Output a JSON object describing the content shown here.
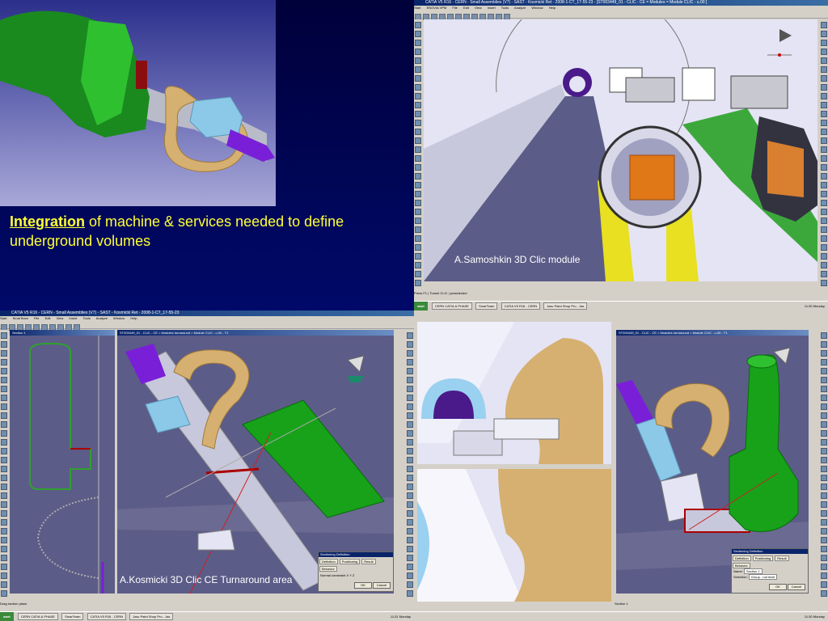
{
  "caption": {
    "keyword": "Integration",
    "text": " of machine & services needed to define underground volumes"
  },
  "credits": {
    "samoshkin": "A.Samoshkin 3D Clic module",
    "kosmicki": "A.Kosmicki 3D Clic CE Turnaround area"
  },
  "catia_top": {
    "title": "CATIA V5 R16 - CERN - Small Assemblies (V7) - SAST - Kosmicki Ret - 2008-1-CT_17-55-23 - [ST003449_01 - CLIC - CE = Modules = Module CLIC - u.00 ]",
    "menu": [
      "Start",
      "ENOVIA VPM",
      "File",
      "Edit",
      "View",
      "Insert",
      "Tools",
      "Analyze",
      "Window",
      "Help"
    ],
    "status": "Press F1 | Tunnel CLIC | preselected",
    "taskbar": {
      "start": "start",
      "buttons": [
        "CERN CATIA & PHASE",
        "SmarTeam",
        "CATIA V5 R16 - CERN",
        "Jasc Paint Shop Pro - Jas"
      ],
      "time": "11:30",
      "day": "Monday"
    }
  },
  "catia_bottom": {
    "title": "CATIA V5 R16 - CERN - Small Assemblies (V7) - SAST - Kosmicki Ret - 2008-1-CT_17-55-23",
    "menu": [
      "Start",
      "SmarTeam",
      "File",
      "Edit",
      "View",
      "Insert",
      "Tools",
      "Analyze",
      "Window",
      "Help"
    ],
    "sketch_window": "Section 1",
    "model_window": "ST003449_01 - CLIC - CE = Modules turnaround = Module CLIC - u.00 - T1",
    "status": "Drag section plane",
    "taskbar": {
      "start": "start",
      "buttons": [
        "CERN CATIA & PHASE",
        "SmarTeam",
        "CATIA V5 R16 - CERN",
        "Jasc Paint Shop Pro - Jas"
      ],
      "time": "11:31",
      "day": "Monday"
    },
    "section_dialog": {
      "title": "Sectioning Definition",
      "tabs": [
        "Definition",
        "Positioning",
        "Result",
        "Behavior"
      ],
      "field_label": "Normal constraint",
      "options": [
        "X",
        "Y",
        "Z"
      ],
      "ok": "OK",
      "cancel": "Cancel"
    }
  },
  "catia_right": {
    "model_window": "ST003449_01 - CLIC - CE = Modules turnaround = Module CLIC - u.00 - T1",
    "dialog": {
      "title": "Sectioning Definition",
      "tabs": [
        "Definition",
        "Positioning",
        "Result",
        "Behavior"
      ],
      "name_label": "Name",
      "name_value": "Section 1",
      "selection_label": "Selection",
      "selection_value": "Group - not level",
      "ok": "OK",
      "cancel": "Cancel"
    },
    "status": "Section 1",
    "time": "11:30",
    "day": "Monday"
  },
  "colors": {
    "background_top": "#00003a",
    "background_bottom": "#000a6e",
    "caption_yellow": "#ffff33",
    "viewport_lavender": "#e4e4f4",
    "viewport_slate": "#5c5c88",
    "green_part": "#17a21a",
    "gold_pipe": "#d6b070",
    "purple_pipe": "#7a1fd8",
    "light_blue": "#8cc8e8",
    "catia_gray": "#d4d0c8"
  }
}
